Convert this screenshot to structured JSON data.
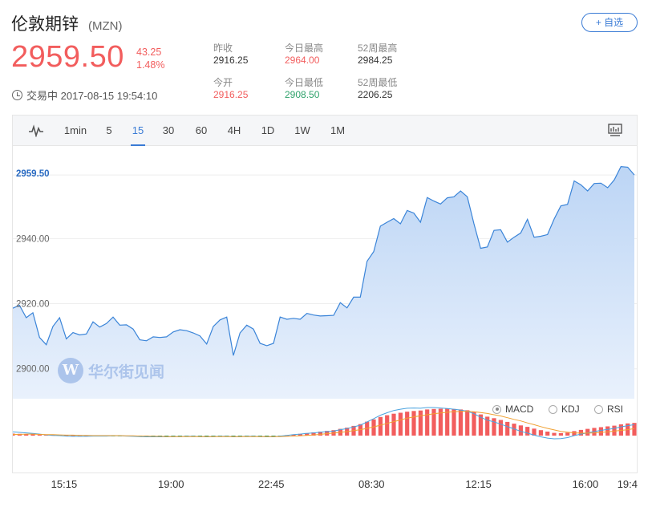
{
  "header": {
    "name": "伦敦期锌",
    "code": "(MZN)",
    "add_label": "+ 自选",
    "price": "2959.50",
    "change": "43.25",
    "change_pct": "1.48%",
    "status": "交易中 2017-08-15 19:54:10"
  },
  "stats": {
    "prev_close_label": "昨收",
    "prev_close": "2916.25",
    "open_label": "今开",
    "open": "2916.25",
    "high_label": "今日最高",
    "high": "2964.00",
    "low_label": "今日最低",
    "low": "2908.50",
    "w52_high_label": "52周最高",
    "w52_high": "2984.25",
    "w52_low_label": "52周最低",
    "w52_low": "2206.25"
  },
  "tabs": [
    "1min",
    "5",
    "15",
    "30",
    "60",
    "4H",
    "1D",
    "1W",
    "1M"
  ],
  "active_tab": "15",
  "indicators": [
    {
      "label": "MACD",
      "selected": true
    },
    {
      "label": "KDJ",
      "selected": false
    },
    {
      "label": "RSI",
      "selected": false
    }
  ],
  "watermark": "华尔街见闻",
  "colors": {
    "accent": "#3a7bd5",
    "up": "#f25d5d",
    "down": "#2fa26b",
    "line": "#3a84d8",
    "area": "#c9dcf6",
    "dif": "#4aa3df",
    "dea": "#f0a030"
  },
  "chart_data": {
    "type": "area",
    "title": "",
    "ylim": [
      2895,
      2962
    ],
    "yticks": [
      "2900.00",
      "2920.00",
      "2940.00"
    ],
    "ytick_values": [
      2900,
      2920,
      2940
    ],
    "current_label": "2959.50",
    "xticks": [
      "15:15",
      "19:00",
      "22:45",
      "08:30",
      "12:15",
      "16:00",
      "19:4"
    ],
    "values": [
      2918.6,
      2919.5,
      2915.7,
      2917.2,
      2909.6,
      2907.4,
      2913.0,
      2915.7,
      2909.2,
      2911.1,
      2910.4,
      2910.7,
      2914.4,
      2912.8,
      2913.9,
      2915.9,
      2913.4,
      2913.5,
      2912.2,
      2908.9,
      2908.6,
      2909.8,
      2909.6,
      2909.8,
      2911.3,
      2912.0,
      2911.7,
      2911.0,
      2910.1,
      2907.6,
      2913.0,
      2915.0,
      2915.9,
      2904.1,
      2911.0,
      2913.4,
      2912.2,
      2907.8,
      2907.1,
      2907.8,
      2915.9,
      2915.2,
      2915.5,
      2915.2,
      2917.0,
      2916.5,
      2916.2,
      2916.3,
      2916.4,
      2920.3,
      2918.7,
      2922.0,
      2922.0,
      2933.0,
      2936.0,
      2943.8,
      2945.0,
      2946.1,
      2944.5,
      2948.6,
      2947.8,
      2945.0,
      2952.6,
      2951.5,
      2950.6,
      2952.5,
      2952.8,
      2954.6,
      2952.8,
      2944.5,
      2937.0,
      2937.4,
      2942.5,
      2942.7,
      2938.9,
      2940.4,
      2941.7,
      2945.9,
      2940.4,
      2940.7,
      2941.2,
      2946.0,
      2950.0,
      2950.5,
      2957.7,
      2956.5,
      2954.6,
      2956.9,
      2957.0,
      2955.6,
      2958.0,
      2962.1,
      2961.9,
      2959.5
    ],
    "x_tick_index": [
      8,
      24,
      39,
      54,
      70,
      86,
      101
    ],
    "macd": {
      "histogram": [
        0.8,
        0.7,
        0.6,
        0.5,
        0.4,
        0.4,
        0.3,
        0.3,
        0.2,
        0.2,
        0.2,
        0.1,
        0.1,
        0.0,
        0.0,
        -0.1,
        -0.1,
        -0.1,
        -0.2,
        -0.3,
        -0.3,
        -0.3,
        -0.3,
        -0.3,
        -0.2,
        -0.2,
        -0.2,
        -0.2,
        -0.2,
        -0.3,
        -0.2,
        -0.1,
        -0.1,
        -0.2,
        -0.2,
        -0.2,
        -0.2,
        -0.3,
        -0.3,
        -0.3,
        -0.1,
        0.2,
        0.5,
        0.7,
        1.0,
        1.3,
        1.6,
        1.9,
        2.2,
        2.7,
        3.2,
        3.9,
        4.6,
        5.6,
        6.5,
        7.5,
        8.2,
        8.8,
        9.2,
        9.6,
        9.9,
        10.1,
        10.5,
        10.7,
        10.8,
        10.8,
        10.7,
        10.5,
        10.2,
        9.5,
        8.5,
        7.6,
        7.0,
        6.3,
        5.5,
        4.8,
        4.1,
        3.5,
        2.8,
        2.2,
        1.6,
        1.1,
        1.0,
        1.2,
        1.8,
        2.3,
        2.7,
        3.1,
        3.4,
        3.7,
        4.0,
        4.5,
        4.9,
        5.1
      ],
      "dif": [
        1.5,
        1.3,
        1.1,
        0.9,
        0.6,
        0.3,
        0.1,
        0.0,
        -0.2,
        -0.3,
        -0.3,
        -0.3,
        -0.2,
        -0.2,
        -0.2,
        -0.1,
        -0.1,
        -0.2,
        -0.3,
        -0.4,
        -0.5,
        -0.5,
        -0.5,
        -0.5,
        -0.4,
        -0.4,
        -0.3,
        -0.3,
        -0.4,
        -0.5,
        -0.4,
        -0.3,
        -0.3,
        -0.5,
        -0.4,
        -0.3,
        -0.3,
        -0.4,
        -0.5,
        -0.5,
        -0.2,
        0.1,
        0.4,
        0.6,
        0.9,
        1.1,
        1.4,
        1.6,
        1.8,
        2.4,
        2.8,
        3.5,
        4.2,
        5.5,
        6.8,
        8.2,
        9.2,
        10.1,
        10.6,
        11.0,
        11.1,
        11.0,
        11.3,
        11.3,
        11.1,
        10.9,
        10.6,
        10.3,
        9.8,
        8.8,
        7.4,
        6.2,
        5.5,
        4.6,
        3.6,
        2.7,
        1.7,
        1.0,
        0.2,
        -0.5,
        -1.0,
        -1.3,
        -1.2,
        -0.8,
        0.0,
        0.6,
        1.1,
        1.6,
        2.1,
        2.5,
        2.9,
        3.5,
        4.0,
        4.4
      ],
      "dea": [
        0.5,
        0.5,
        0.6,
        0.6,
        0.5,
        0.4,
        0.4,
        0.3,
        0.2,
        0.2,
        0.1,
        0.1,
        0.0,
        0.0,
        0.0,
        0.0,
        0.0,
        -0.1,
        -0.1,
        -0.2,
        -0.2,
        -0.3,
        -0.3,
        -0.4,
        -0.4,
        -0.4,
        -0.4,
        -0.4,
        -0.4,
        -0.4,
        -0.4,
        -0.4,
        -0.4,
        -0.4,
        -0.4,
        -0.4,
        -0.4,
        -0.4,
        -0.4,
        -0.4,
        -0.4,
        -0.3,
        -0.2,
        -0.1,
        0.1,
        0.3,
        0.5,
        0.8,
        1.0,
        1.3,
        1.6,
        2.0,
        2.4,
        2.9,
        3.5,
        4.2,
        4.9,
        5.6,
        6.3,
        7.0,
        7.5,
        8.0,
        8.4,
        8.8,
        9.1,
        9.4,
        9.6,
        9.7,
        9.8,
        9.6,
        9.3,
        8.9,
        8.4,
        7.9,
        7.2,
        6.5,
        5.9,
        5.1,
        4.4,
        3.6,
        2.9,
        2.3,
        1.7,
        1.4,
        1.1,
        1.0,
        1.0,
        1.1,
        1.3,
        1.5,
        1.8,
        2.1,
        2.4,
        2.8
      ]
    }
  }
}
